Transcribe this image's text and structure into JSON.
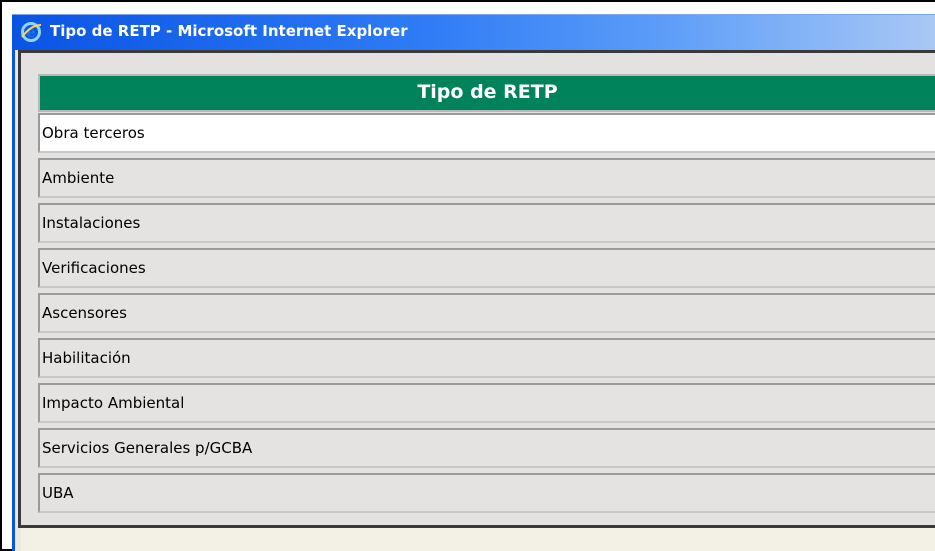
{
  "window": {
    "title": "Tipo de RETP - Microsoft Internet Explorer",
    "title_bar_color": "#0a54e4",
    "icon": "internet-explorer-icon"
  },
  "table": {
    "header": "Tipo de RETP",
    "header_color": "#00835b",
    "rows": [
      "Obra terceros",
      "Ambiente",
      "Instalaciones",
      "Verificaciones",
      "Ascensores",
      "Habilitación",
      "Impacto Ambiental",
      "Servicios Generales p/GCBA",
      "UBA"
    ]
  }
}
